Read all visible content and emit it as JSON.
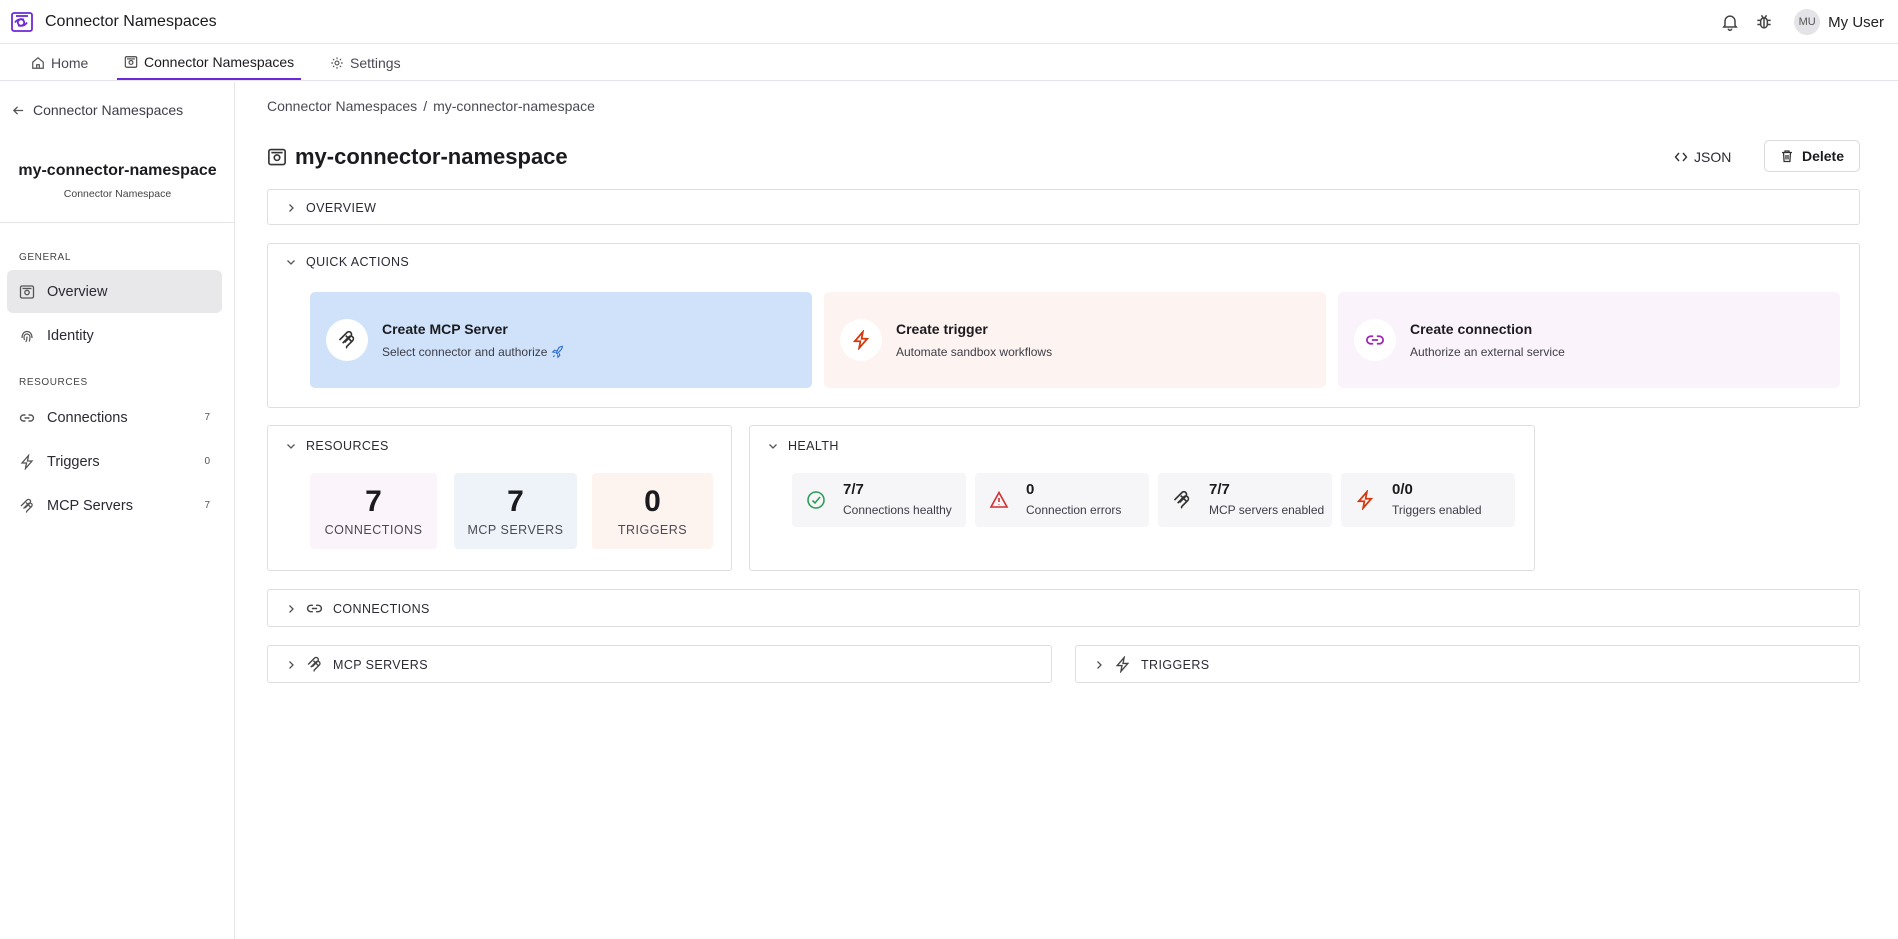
{
  "app": {
    "title": "Connector Namespaces"
  },
  "user": {
    "initials": "MU",
    "name": "My User"
  },
  "tabs": [
    {
      "label": "Home",
      "icon": "home-icon"
    },
    {
      "label": "Connector Namespaces",
      "icon": "namespace-icon",
      "active": true
    },
    {
      "label": "Settings",
      "icon": "gear-icon"
    }
  ],
  "sidebar": {
    "back_label": "Connector Namespaces",
    "namespace_name": "my-connector-namespace",
    "namespace_type": "Connector Namespace",
    "general_heading": "GENERAL",
    "resources_heading": "RESOURCES",
    "items": [
      {
        "label": "Overview",
        "icon": "namespace-icon",
        "active": true
      },
      {
        "label": "Identity",
        "icon": "fingerprint-icon"
      },
      {
        "label": "Connections",
        "icon": "link-icon",
        "count": "7"
      },
      {
        "label": "Triggers",
        "icon": "bolt-icon",
        "count": "0"
      },
      {
        "label": "MCP Servers",
        "icon": "mcp-icon",
        "count": "7"
      }
    ]
  },
  "breadcrumb": {
    "parent": "Connector Namespaces",
    "separator": "/",
    "current": "my-connector-namespace"
  },
  "page": {
    "title": "my-connector-namespace",
    "json_label": "JSON",
    "delete_label": "Delete"
  },
  "sections": {
    "overview": "OVERVIEW",
    "quick_actions": "QUICK ACTIONS",
    "resources": "RESOURCES",
    "health": "HEALTH",
    "connections": "CONNECTIONS",
    "mcp_servers": "MCP SERVERS",
    "triggers": "TRIGGERS"
  },
  "quick_actions": [
    {
      "title": "Create MCP Server",
      "subtitle": "Select connector and authorize",
      "icon": "mcp-icon",
      "extra_icon": "rocket-icon",
      "bg": "#cfe2fa",
      "accent": "#333333"
    },
    {
      "title": "Create trigger",
      "subtitle": "Automate sandbox workflows",
      "icon": "bolt-icon",
      "bg": "#fdf3f0",
      "accent": "#d4380d"
    },
    {
      "title": "Create connection",
      "subtitle": "Authorize an external service",
      "icon": "link-icon",
      "bg": "#fbf3fb",
      "accent": "#9c27b0"
    }
  ],
  "resources": [
    {
      "value": "7",
      "label": "CONNECTIONS",
      "bg": "#fbf4fb"
    },
    {
      "value": "7",
      "label": "MCP SERVERS",
      "bg": "#eef3fa"
    },
    {
      "value": "0",
      "label": "TRIGGERS",
      "bg": "#fdf4f0"
    }
  ],
  "health": [
    {
      "value": "7/7",
      "label": "Connections healthy",
      "icon": "check-circle-icon",
      "color": "#2e9d57"
    },
    {
      "value": "0",
      "label": "Connection errors",
      "icon": "warning-triangle-icon",
      "color": "#d32f2f"
    },
    {
      "value": "7/7",
      "label": "MCP servers enabled",
      "icon": "mcp-icon",
      "color": "#333333"
    },
    {
      "value": "0/0",
      "label": "Triggers enabled",
      "icon": "bolt-icon",
      "color": "#d4380d"
    }
  ]
}
